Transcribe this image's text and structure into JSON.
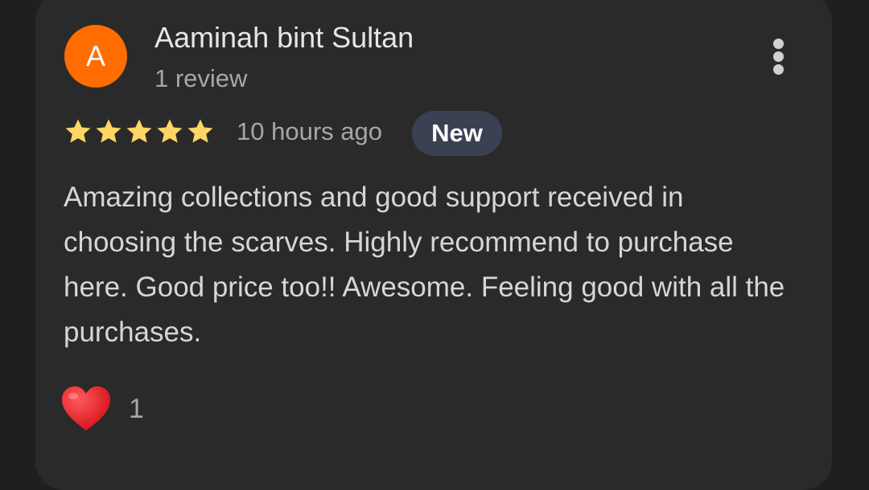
{
  "reviewer": {
    "avatar_letter": "A",
    "avatar_color": "#ff6d00",
    "name": "Aaminah bint Sultan",
    "review_count": "1 review"
  },
  "review": {
    "rating": 5,
    "max_rating": 5,
    "star_color": "#fdd663",
    "timestamp": "10 hours ago",
    "badge": "New",
    "text": "Amazing collections and good support received in choosing the scarves. Highly recommend to purchase here. Good price too!! Awesome. Feeling good with all the purchases."
  },
  "reactions": {
    "icon": "heart-icon",
    "count": "1"
  },
  "menu": {
    "icon": "more-vert-icon"
  }
}
